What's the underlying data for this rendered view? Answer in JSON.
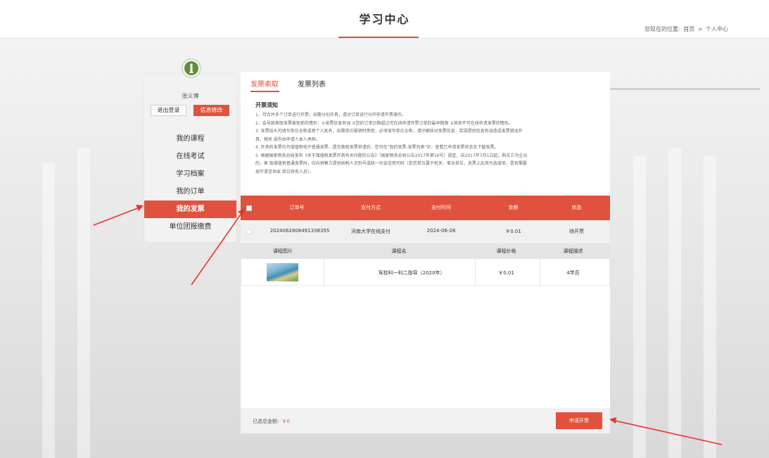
{
  "header": {
    "title": "学习中心",
    "breadcrumb_prefix": "您现在的位置:",
    "breadcrumb_home": "首页",
    "breadcrumb_sep": ">",
    "breadcrumb_current": "个人中心"
  },
  "user": {
    "name": "张义博",
    "logout_label": "退出登录",
    "edit_label": "信息修改"
  },
  "sidebar": {
    "items": [
      {
        "label": "我的课程"
      },
      {
        "label": "在线考试"
      },
      {
        "label": "学习档案"
      },
      {
        "label": "我的订单"
      },
      {
        "label": "我的发票"
      },
      {
        "label": "单位团报缴费"
      }
    ],
    "active_index": 4
  },
  "tabs": {
    "request": "发票索取",
    "list": "发票列表"
  },
  "notice": {
    "title": "开票须知",
    "lines": [
      "1、可合并多个订单进行开票；如需分别开具，请对订单进行分开申请开票操作。",
      "2、会导致索取发票被拒绝的情形：①发票信息有误 ②您的订单日期超过可在线申请开票订单的最早期限 ③其他不可在线申请发票的情形。",
      "3. 发票抬头可填写单位全称或者个人姓名，如需单位报销时使用，必须填写单位全称。请仔细核对发票信息，若因提供信息有误造成发票错误开",
      "具，相关 损失由申请人本人承担。",
      "4. 开具的发票均为增值税电子普通发票，提交索取发票申请后，您可在\"我的发票-发票列表\"中，查看已申请发票状态及下载发票。",
      "5. 根据国家税务总局发布《关于增值税发票开具有关问题的公告》（国家税务总局公告2017年第16号）规定，自2017年7月1日起，购买方为企业",
      "的，索 取增值税普通发票时，应向销售方提供纳税人识别号或统一社会信用代码（若您单位属于机关、事业单位，发票上此项为选填项，是否需要",
      "填写请咨询本 单位财务人员）。"
    ]
  },
  "order_table": {
    "headers": [
      "订单号",
      "支付方式",
      "支付时间",
      "金额",
      "状态"
    ],
    "rows": [
      {
        "order_no": "2024062808491338355",
        "pay_method": "河南大学在线支付",
        "pay_time": "2024-06-28",
        "amount": "￥0.01",
        "status": "待开票"
      }
    ]
  },
  "course_table": {
    "headers": [
      "课程图片",
      "课程名",
      "课程价格",
      "课程描述"
    ],
    "rows": [
      {
        "name": "驾校科一科二指导（2020年）",
        "price": "￥0.01",
        "desc": "4学员"
      }
    ]
  },
  "footer": {
    "total_label": "已选总金额:",
    "total_value": "￥0",
    "apply_label": "申请开票"
  },
  "colors": {
    "accent": "#e0523e",
    "annotation_arrow": "#e8352a"
  }
}
